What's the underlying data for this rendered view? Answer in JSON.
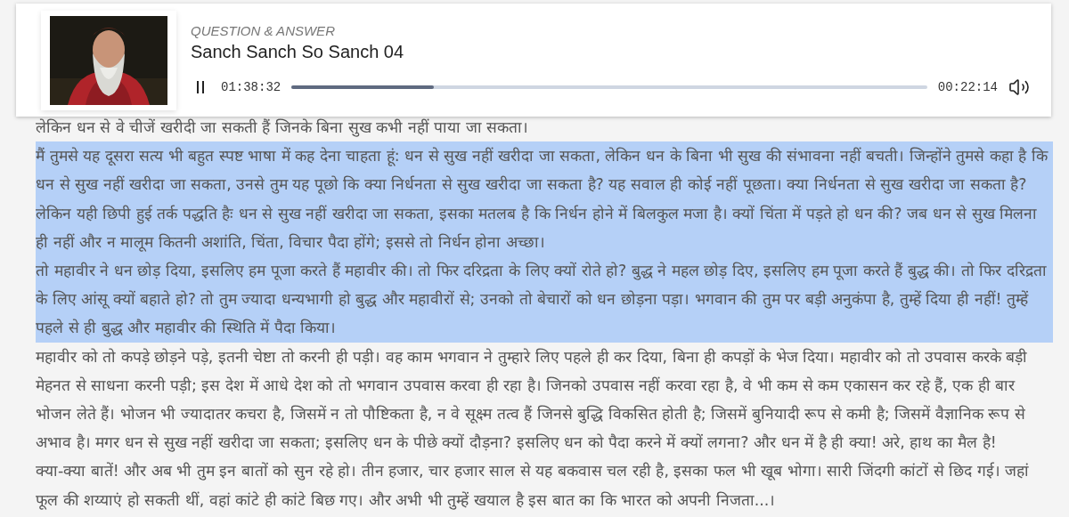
{
  "player": {
    "category": "QUESTION & ANSWER",
    "title": "Sanch Sanch So Sanch 04",
    "playing": true,
    "elapsed": "01:38:32",
    "remaining": "00:22:14",
    "progress": {
      "level": 0.224
    }
  },
  "paragraphs": [
    {
      "text": "लेकिन धन से वे चीजें खरीदी जा सकती हैं जिनके बिना सुख कभी नहीं पाया जा सकता।",
      "selected": false
    },
    {
      "text": "मैं तुमसे यह दूसरा सत्य भी बहुत स्पष्ट भाषा में कह देना चाहता हूं: धन से सुख नहीं खरीदा जा सकता, लेकिन धन के बिना भी सुख की संभावना नहीं बचती। जिन्होंने तुमसे कहा है कि धन से सुख नहीं खरीदा जा सकता, उनसे तुम यह पूछो कि क्या निर्धनता से सुख खरीदा जा सकता है? यह सवाल ही कोई नहीं पूछता। क्या निर्धनता से सुख खरीदा जा सकता है? लेकिन यही छिपी हुई तर्क पद्धति हैः धन से सुख नहीं खरीदा जा सकता, इसका मतलब है कि निर्धन होने में बिलकुल मजा है। क्यों चिंता में पड़ते हो धन की? जब धन से सुख मिलना ही नहीं और न मालूम कितनी अशांति, चिंता, विचार पैदा होंगे; इससे तो निर्धन होना अच्छा।",
      "selected": true
    },
    {
      "text": "तो महावीर ने धन छोड़ दिया, इसलिए हम पूजा करते हैं महावीर की। तो फिर दरिद्रता के लिए क्यों रोते हो? बुद्ध ने महल छोड़ दिए, इसलिए हम पूजा करते हैं बुद्ध की। तो फिर दरिद्रता के लिए आंसू क्यों बहाते हो? तो तुम ज्यादा धन्यभागी हो बुद्ध और महावीरों से; उनको तो बेचारों को धन छोड़ना पड़ा। भगवान की तुम पर बड़ी अनुकंपा है, तुम्हें दिया ही नहीं! तुम्हें पहले से ही बुद्ध और महावीर की स्थिति में पैदा किया।",
      "selected": true
    },
    {
      "text": "महावीर को तो कपड़े छोड़ने पड़े, इतनी चेष्टा तो करनी ही पड़ी। वह काम भगवान ने तुम्हारे लिए पहले ही कर दिया, बिना ही कपड़ों के भेज दिया। महावीर को तो उपवास करके बड़ी मेहनत से साधना करनी पड़ी; इस देश में आधे देश को तो भगवान उपवास करवा ही रहा है। जिनको उपवास नहीं करवा रहा है, वे भी कम से कम एकासन कर रहे हैं, एक ही बार भोजन लेते हैं। भोजन भी ज्यादातर कचरा है, जिसमें न तो पौष्टिकता है, न वे सूक्ष्म तत्व हैं जिनसे बुद्धि विकसित होती है; जिसमें बुनियादी रूप से कमी है; जिसमें वैज्ञानिक रूप से अभाव है। मगर धन से सुख नहीं खरीदा जा सकता; इसलिए धन के पीछे क्यों दौड़ना? इसलिए धन को पैदा करने में क्यों लगना? और धन में है ही क्या! अरे, हाथ का मैल है!",
      "selected": false
    },
    {
      "text": "क्या-क्या बातें! और अब भी तुम इन बातों को सुन रहे हो। तीन हजार, चार हजार साल से यह बकवास चल रही है, इसका फल भी खूब भोगा। सारी जिंदगी कांटों से छिद गई। जहां फूल की शय्याएं हो सकती थीं, वहां कांटे ही कांटे बिछ गए। और अभी भी तुम्हें खयाल है इस बात का कि भारत को अपनी निजता...।",
      "selected": false
    }
  ]
}
